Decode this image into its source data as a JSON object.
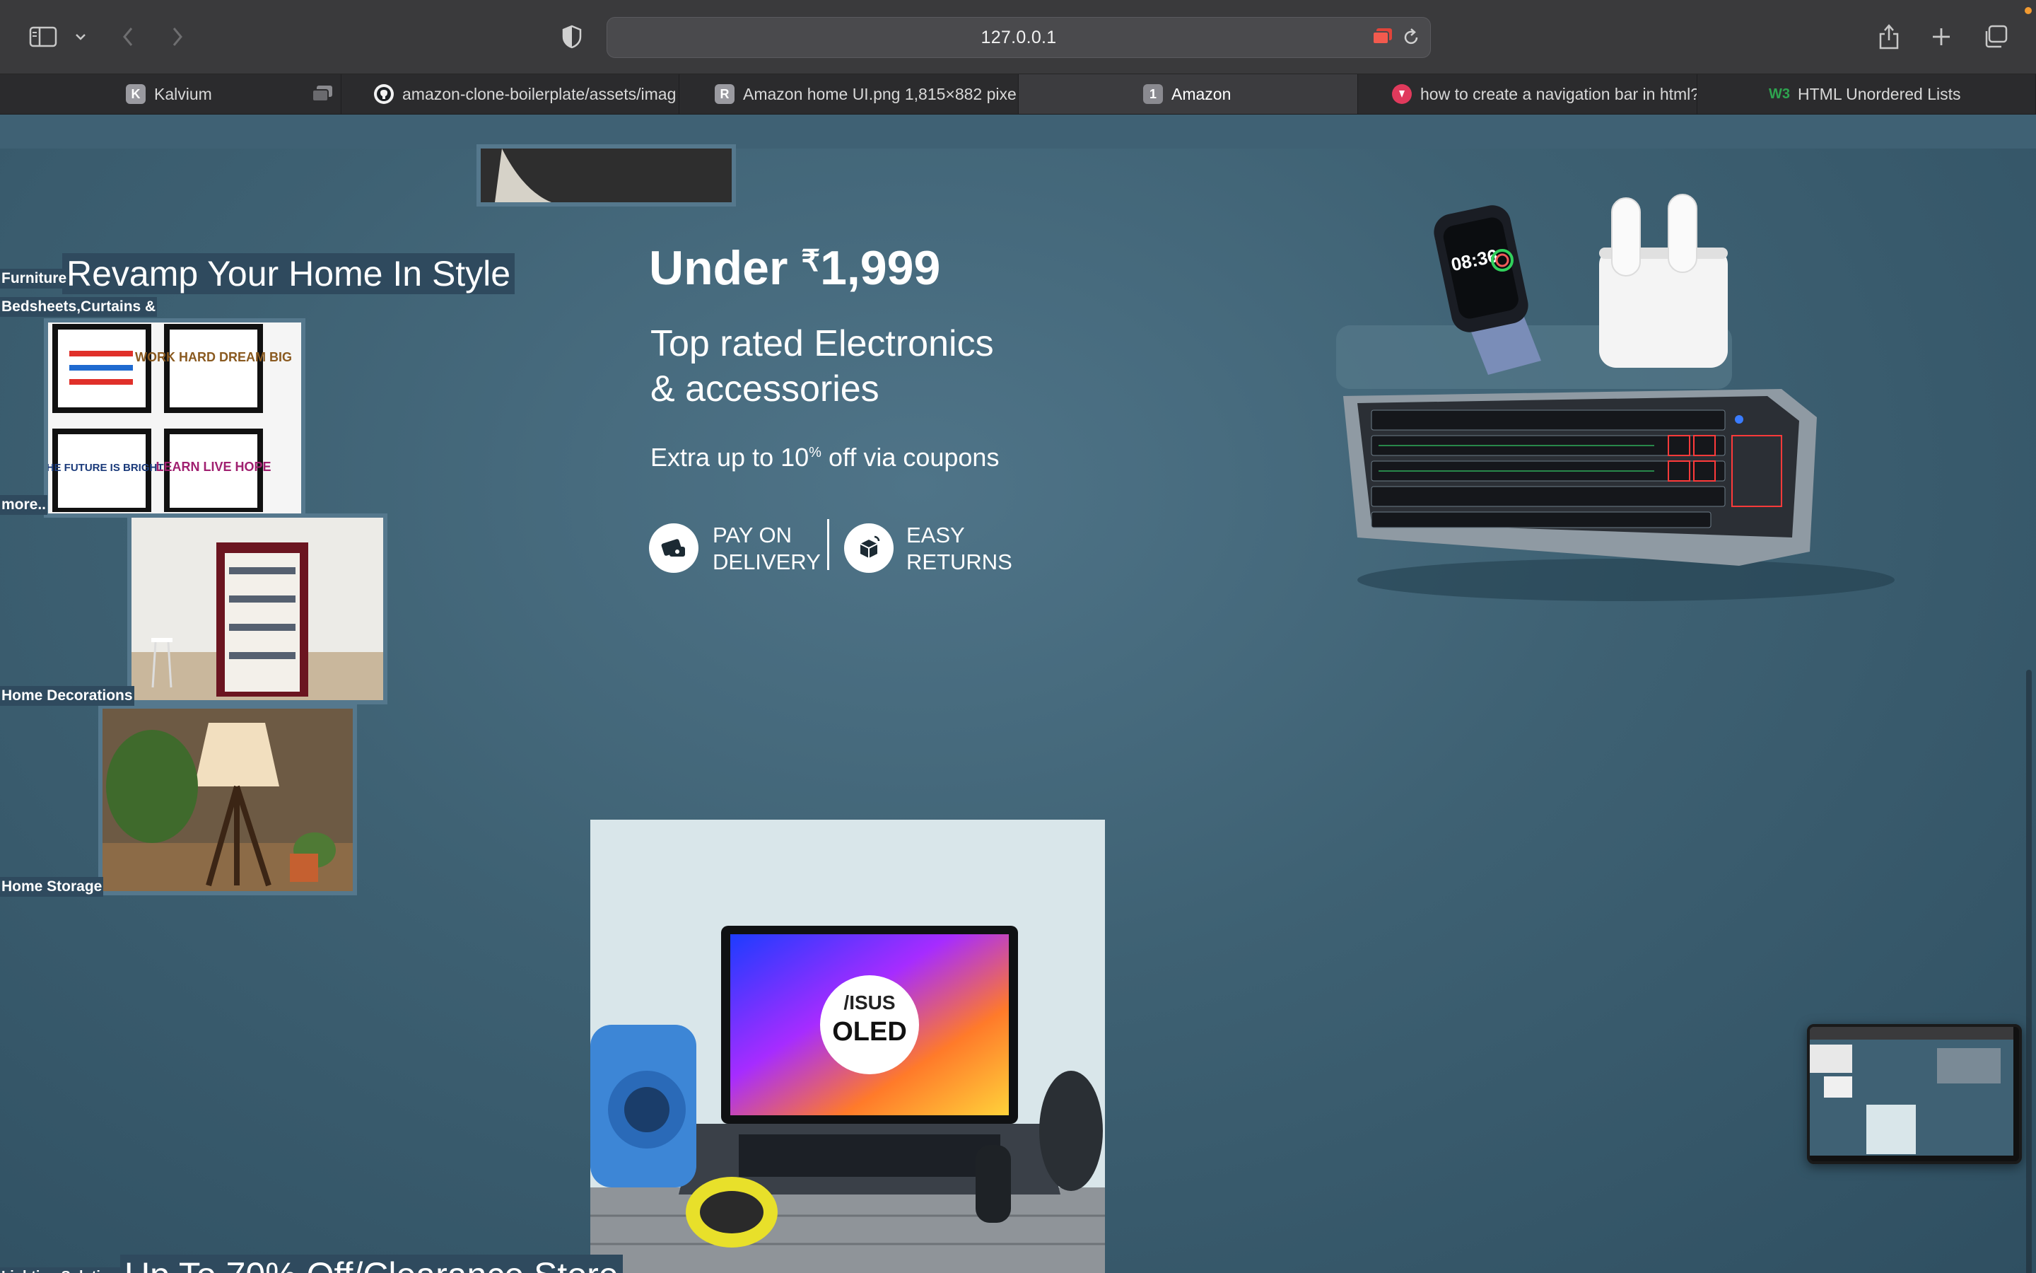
{
  "browser": {
    "url": "127.0.0.1",
    "tabs": [
      {
        "icon_letter": "K",
        "label": "Kalvium",
        "active": false
      },
      {
        "icon_letter": "",
        "label": "amazon-clone-boilerplate/assets/imag",
        "active": false
      },
      {
        "icon_letter": "R",
        "label": "Amazon home UI.png 1,815×882 pixe",
        "active": false
      },
      {
        "icon_letter": "1",
        "label": "Amazon",
        "active": true
      },
      {
        "icon_letter": "",
        "label": "how to create a navigation bar in html?",
        "active": false
      },
      {
        "icon_letter": "W3",
        "label": "HTML Unordered Lists",
        "active": false
      }
    ]
  },
  "hero": {
    "under_prefix": "Under ",
    "rupee": "₹",
    "price": "1,999",
    "subtitle_line1": "Top rated Electronics",
    "subtitle_line2": "& accessories",
    "coupon_prefix": "Extra up to 10",
    "coupon_sup": "%",
    "coupon_suffix": " off via coupons",
    "badge1_line1": "PAY ON",
    "badge1_line2": "DELIVERY",
    "badge2_line1": "EASY",
    "badge2_line2": "RETURNS",
    "watch_time": "08:36",
    "laptop_brand": "/ISUS",
    "laptop_badge": "OLED"
  },
  "categories": {
    "furniture": "Furniture",
    "heading": "Revamp Your Home In Style",
    "bedsheets": "Bedsheets,Curtains &",
    "more": "more..",
    "home_decorations": "Home Decorations",
    "home_storage": "Home Storage",
    "lighting": "Lighting Solutions",
    "clearance": "Up To 70% Off/Clearance Store"
  },
  "poster_texts": [
    "WORK HARD DREAM BIG",
    "THE FUTURE IS BRIGHT",
    "LEARN LIVE HOPE"
  ],
  "colors": {
    "hero_bg": "#3f6174",
    "label_bg": "#2f4a5e",
    "chrome_bg": "#3a3a3c",
    "tab_bg": "#2b2b2d",
    "keyboard_red": "#ff3a3a"
  }
}
